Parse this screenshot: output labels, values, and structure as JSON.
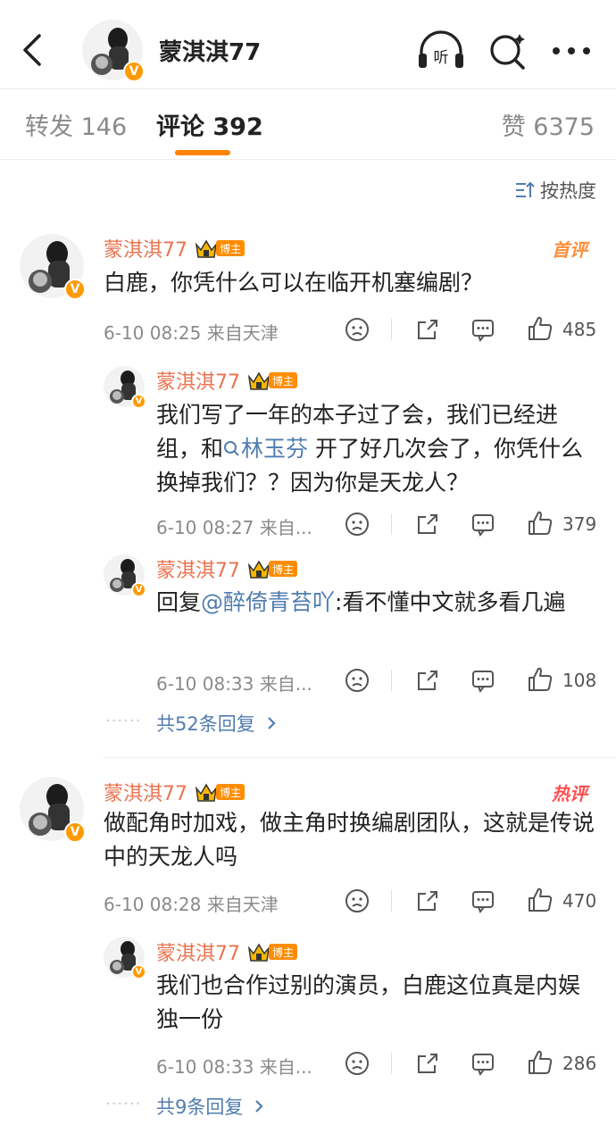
{
  "header": {
    "title": "蒙淇淇77",
    "listen_label": "听"
  },
  "tabs": {
    "repost": "转发 146",
    "comment": "评论 392",
    "like": "赞 6375"
  },
  "sort_label": "按热度",
  "badges": {
    "verified": "V",
    "bozhu": "博主",
    "first_comment": "首评",
    "hot_comment": "热评"
  },
  "comments": [
    {
      "name": "蒙淇淇77",
      "text": "白鹿，你凭什么可以在临开机塞编剧？",
      "meta": "6-10 08:25 来自天津",
      "likes": "485",
      "replies": [
        {
          "name": "蒙淇淇77",
          "text_parts": [
            "我们写了一年的本子过了会，我们已经进组，和",
            "林玉芬",
            " 开了好几次会了，你凭什么换掉我们？？因为你是天龙人？"
          ],
          "meta": "6-10 08:27 来自...",
          "likes": "379"
        },
        {
          "name": "蒙淇淇77",
          "text_parts": [
            "回复",
            "@醉倚青苔吖",
            ":看不懂中文就多看几遍"
          ],
          "meta": "6-10 08:33 来自...",
          "likes": "108"
        }
      ],
      "more_replies": "共52条回复"
    },
    {
      "name": "蒙淇淇77",
      "text": "做配角时加戏，做主角时换编剧团队，这就是传说中的天龙人吗",
      "meta": "6-10 08:28 来自天津",
      "likes": "470",
      "replies": [
        {
          "name": "蒙淇淇77",
          "text": "我们也合作过别的演员，白鹿这位真是内娱独一份",
          "meta": "6-10 08:33 来自...",
          "likes": "286"
        }
      ],
      "more_replies": "共9条回复"
    }
  ],
  "colors": {
    "accent": "#ff8200",
    "username": "#eb7350",
    "link": "#507daf",
    "muted": "#8a8a8a"
  }
}
